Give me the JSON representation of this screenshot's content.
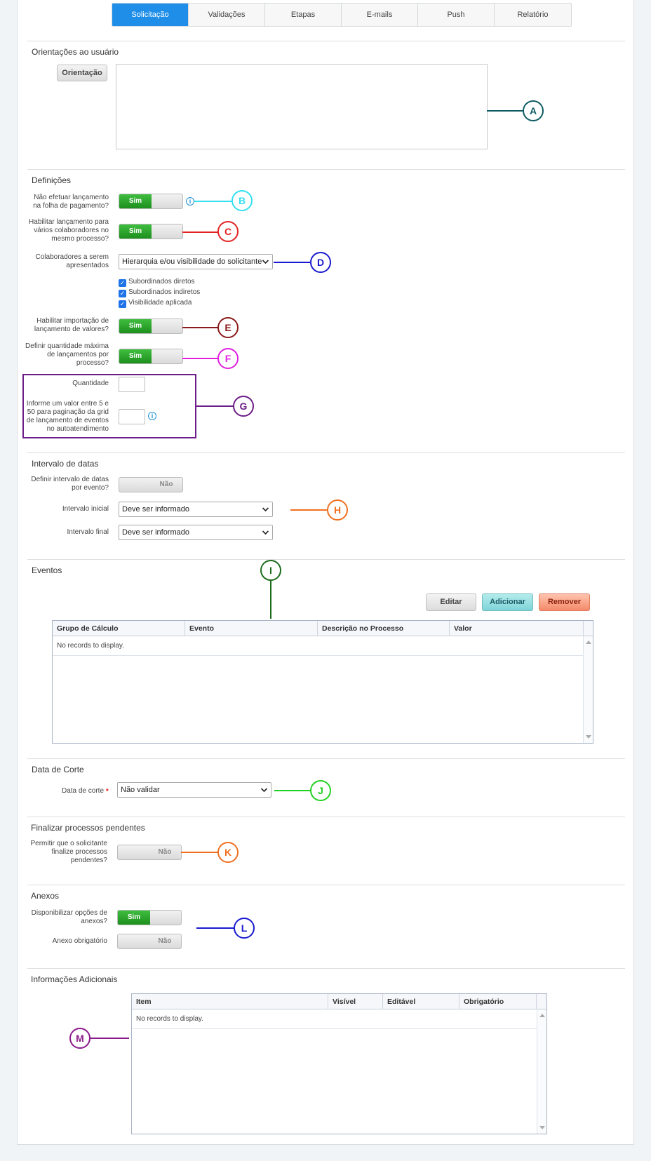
{
  "tabs": [
    "Solicitação",
    "Validações",
    "Etapas",
    "E-mails",
    "Push",
    "Relatório"
  ],
  "orientacoes": {
    "title": "Orientações ao usuário",
    "button": "Orientação"
  },
  "definicoes": {
    "title": "Definições",
    "q1": "Não efetuar lançamento na folha de pagamento?",
    "q2": "Habilitar lançamento para vários colaboradores no mesmo processo?",
    "q3": "Colaboradores a serem apresentados",
    "q3_select": "Hierarquia e/ou visibilidade do solicitante",
    "checks": [
      "Subordinados diretos",
      "Subordinados indiretos",
      "Visibilidade aplicada"
    ],
    "q4": "Habilitar importação de lançamento de valores?",
    "q5": "Definir quantidade máxima de lançamentos por processo?",
    "quantidade": "Quantidade",
    "paginacao": "Informe um valor entre 5 e 50 para paginação da grid de lançamento de eventos no autoatendimento"
  },
  "toggle": {
    "on": "Sim",
    "off": "Não"
  },
  "intervalo": {
    "title": "Intervalo de datas",
    "q1": "Definir intervalo de datas por evento?",
    "inicial": "Intervalo inicial",
    "inicial_value": "Deve ser informado",
    "final": "Intervalo final",
    "final_value": "Deve ser informado"
  },
  "eventos": {
    "title": "Eventos",
    "buttons": {
      "edit": "Editar",
      "add": "Adicionar",
      "remove": "Remover"
    },
    "columns": [
      "Grupo de Cálculo",
      "Evento",
      "Descrição no Processo",
      "Valor"
    ],
    "empty": "No records to display."
  },
  "corte": {
    "title": "Data de Corte",
    "label": "Data de corte",
    "required": "•",
    "value": "Não validar"
  },
  "finalizar": {
    "title": "Finalizar processos pendentes",
    "q1": "Permitir que o solicitante finalize processos pendentes?"
  },
  "anexos": {
    "title": "Anexos",
    "q1": "Disponibilizar opções de anexos?",
    "q2": "Anexo obrigatório"
  },
  "adicionais": {
    "title": "Informações Adicionais",
    "columns": [
      "Item",
      "Visível",
      "Editável",
      "Obrigatório"
    ],
    "empty": "No records to display."
  },
  "info_icon": "info-icon",
  "markers": [
    "A",
    "B",
    "C",
    "D",
    "E",
    "F",
    "G",
    "H",
    "I",
    "J",
    "K",
    "L",
    "M"
  ],
  "colors": {
    "A": "#0d5c63",
    "B": "#33e0f0",
    "C": "#e32222",
    "D": "#1a1ad0",
    "E": "#8b1a1a",
    "F": "#e020e0",
    "G": "#6d1d87",
    "H": "#f07020",
    "I": "#1a6b1a",
    "J": "#22d022",
    "K": "#f07020",
    "L": "#1a1ad0",
    "M": "#8b1a8b",
    "accent": "#1e8ee8"
  }
}
